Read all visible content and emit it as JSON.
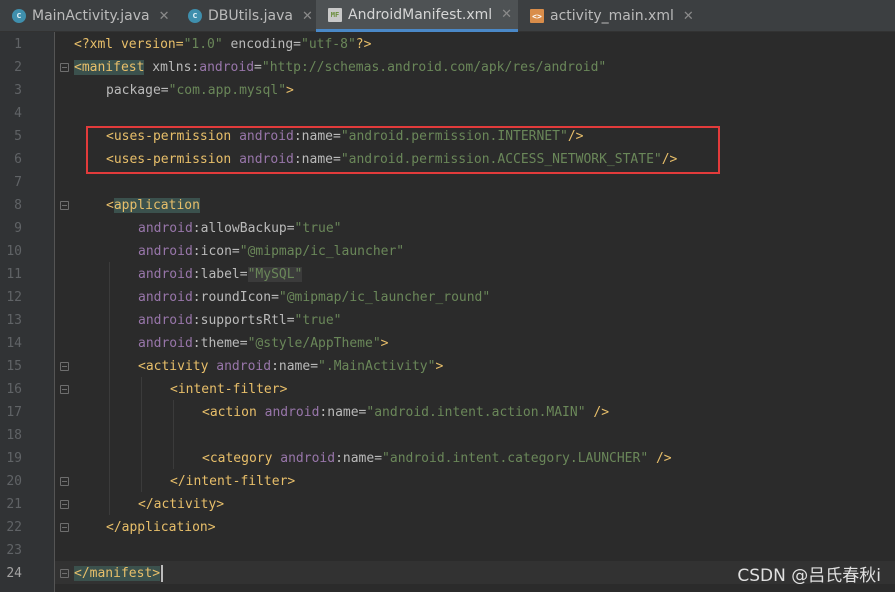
{
  "tabs": [
    {
      "label": "MainActivity.java",
      "icon": "java-class-icon",
      "active": false
    },
    {
      "label": "DBUtils.java",
      "icon": "java-class-icon",
      "active": false
    },
    {
      "label": "AndroidManifest.xml",
      "icon": "manifest-file-icon",
      "active": true
    },
    {
      "label": "activity_main.xml",
      "icon": "layout-xml-icon",
      "active": false
    }
  ],
  "tab_icon_labels": {
    "class": "c",
    "manifest": "MF",
    "layout": "<>"
  },
  "close_glyph": "✕",
  "line_numbers": [
    "1",
    "2",
    "3",
    "4",
    "5",
    "6",
    "7",
    "8",
    "9",
    "10",
    "11",
    "12",
    "13",
    "14",
    "15",
    "16",
    "17",
    "18",
    "19",
    "20",
    "21",
    "22",
    "23",
    "24"
  ],
  "code": {
    "l1": {
      "open": "<?xml version=",
      "version": "\"1.0\"",
      "mid": " encoding=",
      "encoding": "\"utf-8\"",
      "close": "?>"
    },
    "l2": {
      "lt": "<",
      "tag": "manifest",
      "sp": " ",
      "attr": "xmlns:",
      "ns": "android",
      "eq": "=",
      "val": "\"http://schemas.android.com/apk/res/android\""
    },
    "l3": {
      "attr": "package=",
      "val": "\"com.app.mysql\"",
      "close": ">"
    },
    "l5": {
      "tag": "<uses-permission ",
      "ns": "android",
      "attr": ":name=",
      "val": "\"android.permission.INTERNET\"",
      "close": "/>"
    },
    "l6": {
      "tag": "<uses-permission ",
      "ns": "android",
      "attr": ":name=",
      "val": "\"android.permission.ACCESS_NETWORK_STATE\"",
      "close": "/>"
    },
    "l8": {
      "lt": "<",
      "tag": "application"
    },
    "l9": {
      "ns": "android",
      "attr": ":allowBackup=",
      "val": "\"true\""
    },
    "l10": {
      "ns": "android",
      "attr": ":icon=",
      "val": "\"@mipmap/ic_launcher\""
    },
    "l11": {
      "ns": "android",
      "attr": ":label=",
      "val": "\"MySQL\""
    },
    "l12": {
      "ns": "android",
      "attr": ":roundIcon=",
      "val": "\"@mipmap/ic_launcher_round\""
    },
    "l13": {
      "ns": "android",
      "attr": ":supportsRtl=",
      "val": "\"true\""
    },
    "l14": {
      "ns": "android",
      "attr": ":theme=",
      "val": "\"@style/AppTheme\"",
      "close": ">"
    },
    "l15": {
      "tag": "<activity ",
      "ns": "android",
      "attr": ":name=",
      "val": "\".MainActivity\"",
      "close": ">"
    },
    "l16": {
      "tag": "<intent-filter>"
    },
    "l17": {
      "tag": "<action ",
      "ns": "android",
      "attr": ":name=",
      "val": "\"android.intent.action.MAIN\"",
      "close": " />"
    },
    "l19": {
      "tag": "<category ",
      "ns": "android",
      "attr": ":name=",
      "val": "\"android.intent.category.LAUNCHER\"",
      "close": " />"
    },
    "l20": {
      "tag": "</intent-filter>"
    },
    "l21": {
      "tag": "</activity>"
    },
    "l22": {
      "tag": "</application>"
    },
    "l24": {
      "tag": "</manifest>"
    }
  },
  "watermark": "CSDN @吕氏春秋i",
  "highlight_color": "#e23b3b",
  "colors": {
    "tag": "#e8bf6a",
    "namespace": "#9876aa",
    "string": "#6a8759",
    "text": "#a9b7c6",
    "background": "#2b2b2b"
  }
}
